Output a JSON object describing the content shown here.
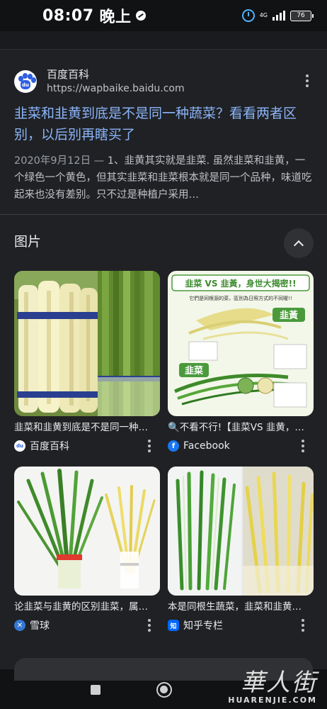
{
  "status_bar": {
    "time": "08:07",
    "period": "晚上",
    "network": "4G",
    "battery": "76"
  },
  "result": {
    "source_name": "百度百科",
    "source_url": "https://wapbaike.baidu.com",
    "logo_text": "du",
    "title": "韭菜和韭黄到底是不是同一种蔬菜？看看两者区别，以后别再瞎买了",
    "date": "2020年9月12日 —",
    "snippet": " 1、韭黄其实就是韭菜. 虽然韭菜和韭黄，一个绿色一个黄色，但其实韭菜和韭菜根本就是同一个品种，味道吃起来也没有差别。只不过是种植户采用…"
  },
  "images": {
    "header": "图片",
    "items": [
      {
        "caption": "韭菜和韭黄到底是不是同一种…",
        "source": "百度百科",
        "icon": "baidu-icon"
      },
      {
        "caption": "🔍不看不行!【韭菜VS 韭黄，…",
        "source": "Facebook",
        "icon": "facebook-icon"
      },
      {
        "caption": "论韭菜与韭黄的区别韭菜，属…",
        "source": "雪球",
        "icon": "xueqiu-icon"
      },
      {
        "caption": "本是同根生蔬菜，韭菜和韭黄…",
        "source": "知乎专栏",
        "icon": "zhihu-icon"
      }
    ],
    "infographic": {
      "banner": "韭菜 VS 韭黃，身世大揭密!!",
      "subtitle": "它們是同根源的菜，區別為日照方式的不同喔!!",
      "label_yellow": "韭黃",
      "label_green": "韭菜"
    },
    "source_icon_letters": {
      "facebook": "f",
      "zhihu": "知",
      "baidu": "du"
    }
  },
  "watermark": {
    "chinese": "華人街",
    "english": "HUARENJIE.COM"
  },
  "colors": {
    "background": "#202124",
    "title_link": "#8ab4f8",
    "facebook": "#1877f2",
    "zhihu": "#0066ff",
    "xueqiu": "#3478d4"
  }
}
